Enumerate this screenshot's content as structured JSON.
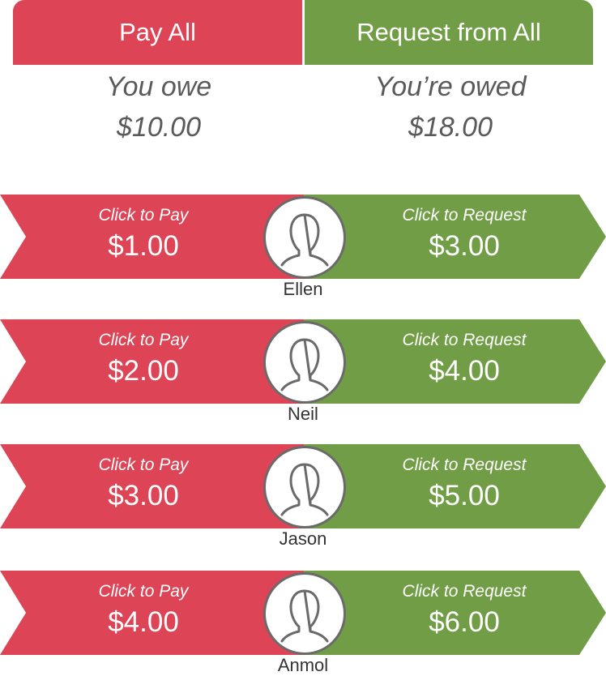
{
  "header": {
    "pay_all_label": "Pay All",
    "request_all_label": "Request from All"
  },
  "summary": {
    "owe_label": "You owe",
    "owe_amount": "$10.00",
    "owed_label": "You’re owed",
    "owed_amount": "$18.00"
  },
  "people": [
    {
      "name": "Ellen",
      "pay_caption": "Click to Pay",
      "pay_amount": "$1.00",
      "request_caption": "Click to Request",
      "request_amount": "$3.00"
    },
    {
      "name": "Neil",
      "pay_caption": "Click to Pay",
      "pay_amount": "$2.00",
      "request_caption": "Click to Request",
      "request_amount": "$4.00"
    },
    {
      "name": "Jason",
      "pay_caption": "Click to Pay",
      "pay_amount": "$3.00",
      "request_caption": "Click to Request",
      "request_amount": "$5.00"
    },
    {
      "name": "Anmol",
      "pay_caption": "Click to Pay",
      "pay_amount": "$4.00",
      "request_caption": "Click to Request",
      "request_amount": "$6.00"
    }
  ],
  "colors": {
    "pay": "#dd4455",
    "request": "#709d45",
    "avatar_stroke": "#6a6a6a"
  },
  "icons": {
    "avatar": "person-silhouette-icon"
  }
}
